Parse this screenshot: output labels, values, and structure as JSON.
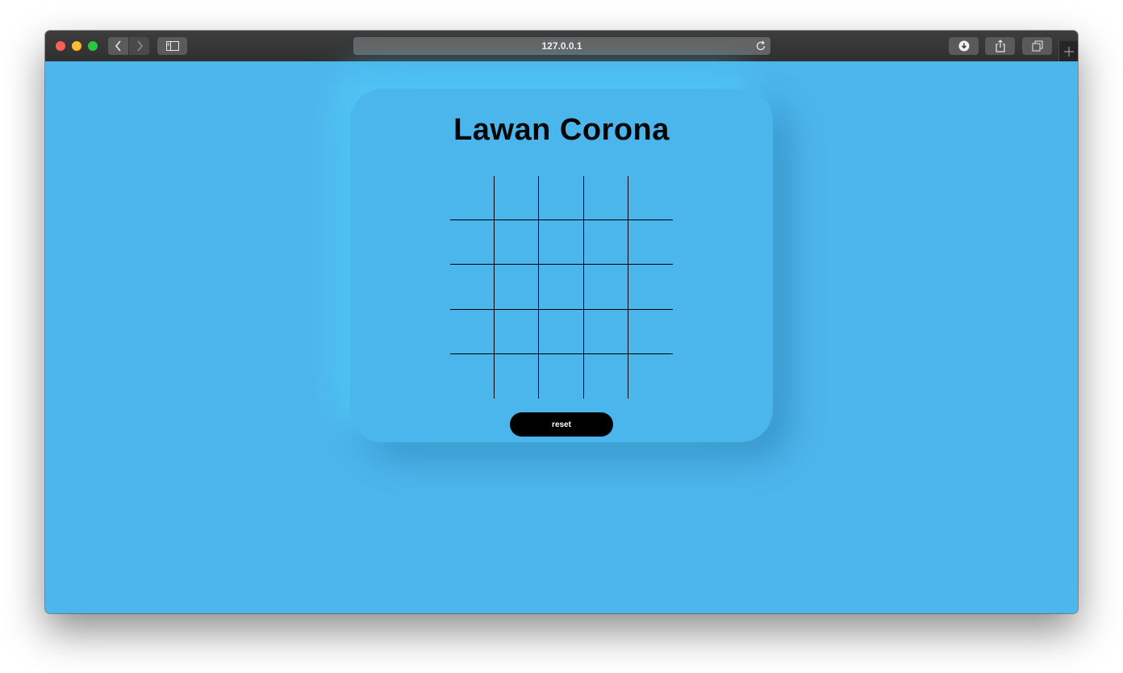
{
  "browser": {
    "address": "127.0.0.1"
  },
  "page": {
    "title": "Lawan Corona",
    "reset_label": "reset",
    "grid": {
      "rows": 5,
      "cols": 5,
      "cells": [
        "",
        "",
        "",
        "",
        "",
        "",
        "",
        "",
        "",
        "",
        "",
        "",
        "",
        "",
        "",
        "",
        "",
        "",
        "",
        "",
        "",
        "",
        "",
        "",
        ""
      ]
    }
  },
  "colors": {
    "background": "#4db6ec",
    "card": "#4bb6ec",
    "button": "#000000",
    "button_text": "#ffffff"
  }
}
